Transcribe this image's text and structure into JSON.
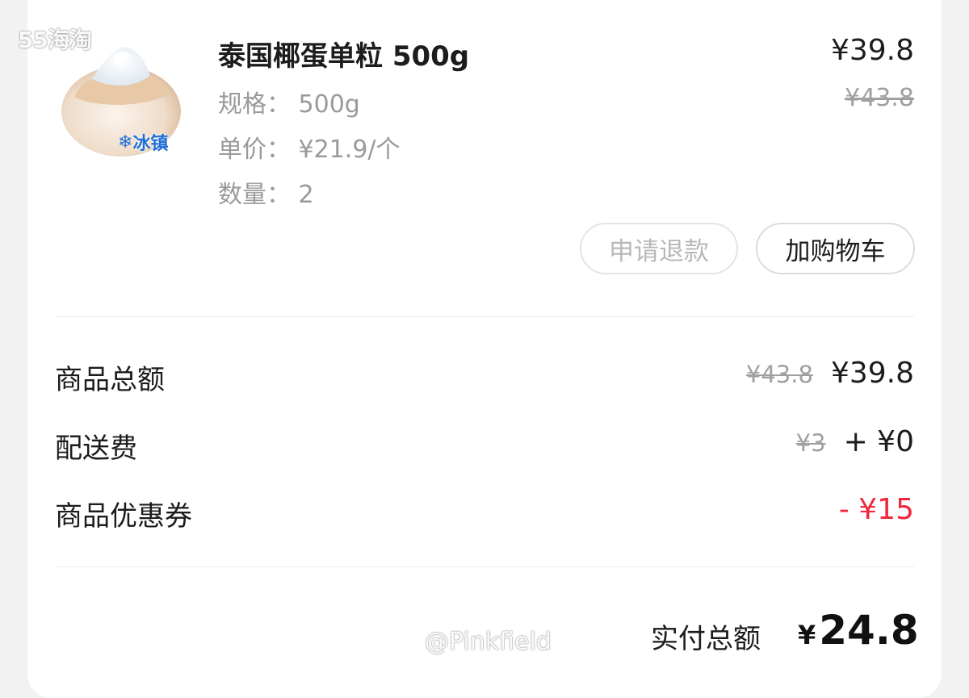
{
  "watermark_top": "55海淘",
  "item": {
    "title": "泰国椰蛋单粒 500g",
    "spec": "规格：  500g",
    "unit_price": "单价：  ¥21.9/个",
    "quantity": "数量：  2",
    "price_now": "¥39.8",
    "price_orig": "¥43.8",
    "badge": "冰镇",
    "refund_button": "申请退款",
    "cart_button": "加购物车"
  },
  "summary": {
    "goods_total_label": "商品总额",
    "goods_total_orig": "¥43.8",
    "goods_total_now": "¥39.8",
    "delivery_label": "配送费",
    "delivery_orig": "¥3",
    "delivery_now": "+ ¥0",
    "coupon_label": "商品优惠券",
    "coupon_value": "- ¥15"
  },
  "total": {
    "label": "实付总额",
    "currency": "¥",
    "amount": "24.8"
  },
  "watermark_bottom": "@Pinkfield",
  "colors": {
    "accent_red": "#f0283c",
    "muted_text": "#9a9a9a",
    "text": "#1c1c1c"
  }
}
